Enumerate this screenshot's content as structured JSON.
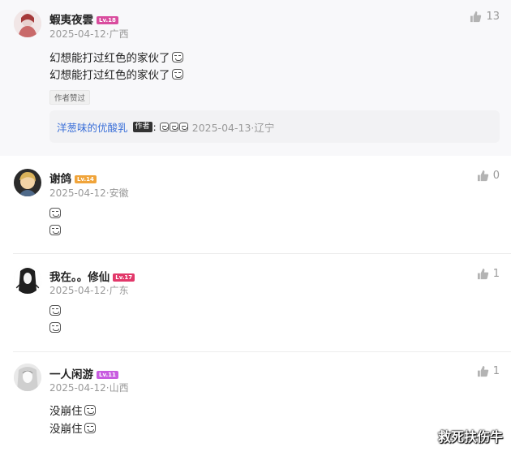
{
  "comments": [
    {
      "username": "蝦夷夜雲",
      "level": "Lv.18",
      "level_color": "#d94c9e",
      "date": "2025-04-12",
      "location": "广西",
      "likes": "13",
      "lines": [
        "幻想能打过红色的家伙了",
        "幻想能打过红色的家伙了"
      ],
      "tag": "作者赞过",
      "reply": {
        "username": "洋葱味的优酸乳",
        "badge": "作者",
        "date": "2025-04-13",
        "location": "辽宁"
      }
    },
    {
      "username": "谢鸽",
      "level": "Lv.14",
      "level_color": "#f0a43a",
      "date": "2025-04-12",
      "location": "安徽",
      "likes": "0",
      "lines": [
        "",
        ""
      ]
    },
    {
      "username": "我在。。修仙",
      "level": "Lv.17",
      "level_color": "#e2386a",
      "date": "2025-04-12",
      "location": "广东",
      "likes": "1",
      "lines": [
        "",
        ""
      ]
    },
    {
      "username": "一人闲游",
      "level": "Lv.11",
      "level_color": "#c85ce0",
      "date": "2025-04-12",
      "location": "山西",
      "likes": "1",
      "lines": [
        "没崩住",
        "没崩住"
      ]
    }
  ],
  "separator": "·",
  "watermark": "救死扶伤牛",
  "icons": {
    "like": "thumbs-up-icon",
    "emoji": "laugh-emoji-icon"
  }
}
